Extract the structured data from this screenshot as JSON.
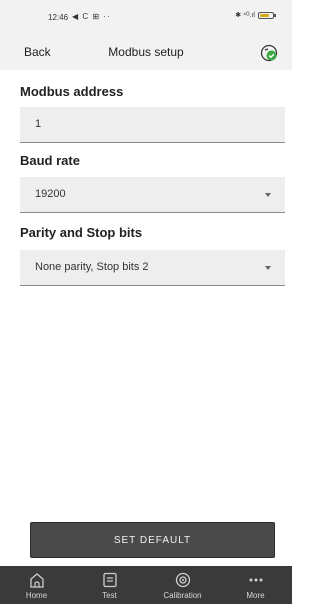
{
  "status_bar": {
    "time": "12:46",
    "left_icons": "◀ C ⊞ ··",
    "right_icons": "✱ ⁴ᴳ.ıl"
  },
  "nav": {
    "back_label": "Back",
    "title": "Modbus setup",
    "action_icon": "device-check-icon"
  },
  "form": {
    "address": {
      "label": "Modbus address",
      "value": "1"
    },
    "baud": {
      "label": "Baud rate",
      "value": "19200"
    },
    "parity": {
      "label": "Parity and Stop bits",
      "value": "None parity, Stop bits 2"
    }
  },
  "set_default_label": "SET DEFAULT",
  "tabs": [
    {
      "label": "Home",
      "icon": "home-icon"
    },
    {
      "label": "Test",
      "icon": "test-icon"
    },
    {
      "label": "Calibration",
      "icon": "calibration-icon"
    },
    {
      "label": "More",
      "icon": "more-icon"
    }
  ],
  "colors": {
    "accent_green": "#3aa845",
    "button_bg": "#4a4a4a",
    "tabbar_bg": "#3a3a3a"
  }
}
